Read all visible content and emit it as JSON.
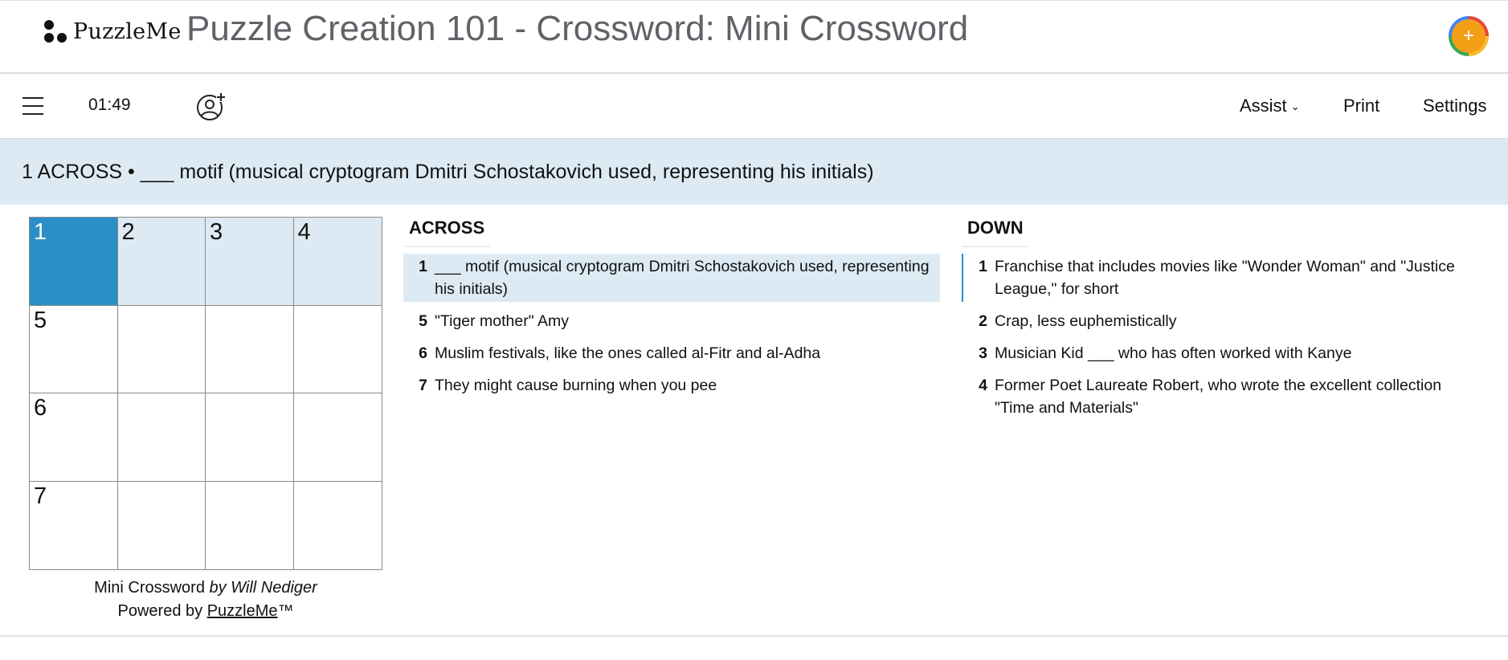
{
  "header": {
    "logo_text": "PuzzleMe",
    "title": "Puzzle Creation 101 - Crossword: Mini Crossword",
    "avatar_symbol": "+"
  },
  "toolbar": {
    "menu_icon": "hamburger-menu-icon",
    "timer": "01:49",
    "invite_icon": "add-user-icon",
    "assist_label": "Assist",
    "assist_chevron": "⌄",
    "print_label": "Print",
    "settings_label": "Settings"
  },
  "current_clue": "1 ACROSS • ___ motif (musical cryptogram Dmitri Schostakovich used, representing his initials)",
  "colors": {
    "active_cell": "#2a8fc7",
    "highlight": "#ddeaf3",
    "title_gray": "#5f6368"
  },
  "grid": {
    "rows": 4,
    "cols": 4,
    "cells": [
      {
        "num": "1",
        "state": "active"
      },
      {
        "num": "2",
        "state": "word"
      },
      {
        "num": "3",
        "state": "word"
      },
      {
        "num": "4",
        "state": "word"
      },
      {
        "num": "5",
        "state": ""
      },
      {
        "num": "",
        "state": ""
      },
      {
        "num": "",
        "state": ""
      },
      {
        "num": "",
        "state": ""
      },
      {
        "num": "6",
        "state": ""
      },
      {
        "num": "",
        "state": ""
      },
      {
        "num": "",
        "state": ""
      },
      {
        "num": "",
        "state": ""
      },
      {
        "num": "7",
        "state": ""
      },
      {
        "num": "",
        "state": ""
      },
      {
        "num": "",
        "state": ""
      },
      {
        "num": "",
        "state": ""
      }
    ]
  },
  "credit": {
    "puzzle_name": "Mini Crossword",
    "by_author": "by Will Nediger",
    "powered_by": "Powered by",
    "brand": "PuzzleMe",
    "tm": "™"
  },
  "across": {
    "heading": "ACROSS",
    "clues": [
      {
        "num": "1",
        "text": "___ motif (musical cryptogram Dmitri Schostakovich used, representing his initials)"
      },
      {
        "num": "5",
        "text": "\"Tiger mother\" Amy"
      },
      {
        "num": "6",
        "text": "Muslim festivals, like the ones called al-Fitr and al-Adha"
      },
      {
        "num": "7",
        "text": "They might cause burning when you pee"
      }
    ]
  },
  "down": {
    "heading": "DOWN",
    "clues": [
      {
        "num": "1",
        "text": "Franchise that includes movies like \"Wonder Woman\" and \"Justice League,\" for short"
      },
      {
        "num": "2",
        "text": "Crap, less euphemistically"
      },
      {
        "num": "3",
        "text": "Musician Kid ___ who has often worked with Kanye"
      },
      {
        "num": "4",
        "text": "Former Poet Laureate Robert, who wrote the excellent collection \"Time and Materials\""
      }
    ]
  }
}
